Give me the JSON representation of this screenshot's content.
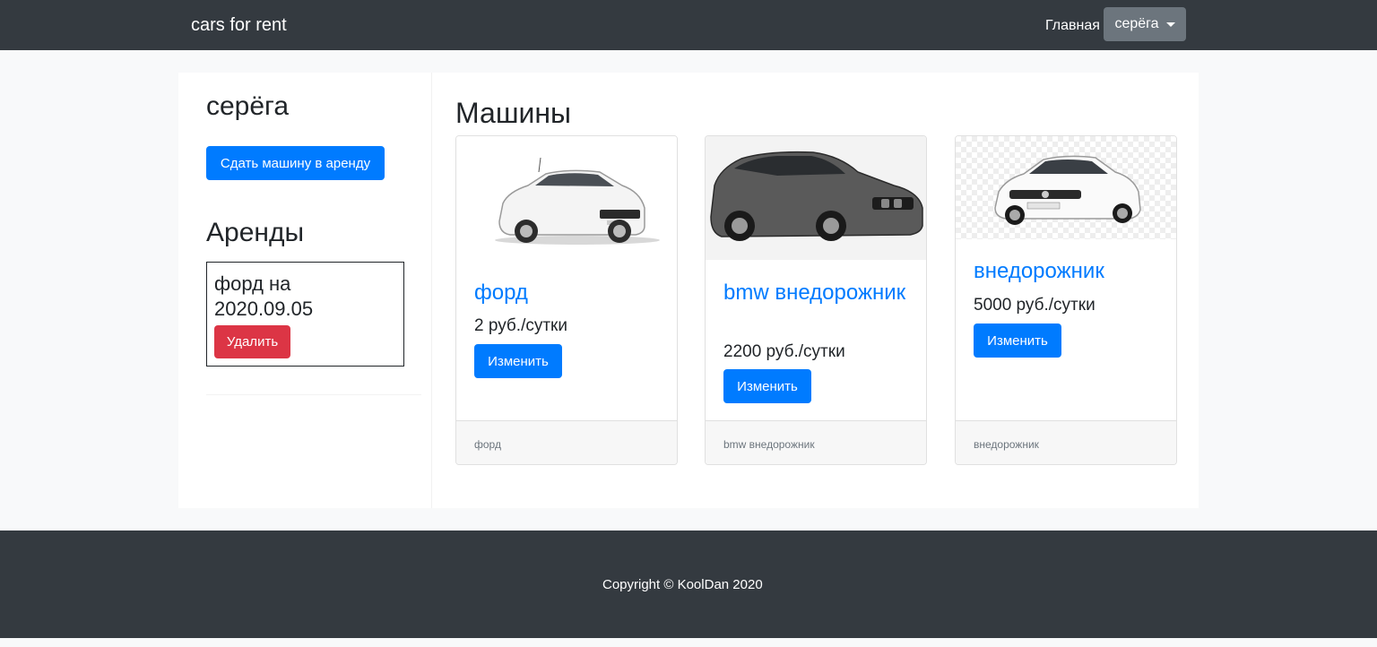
{
  "navbar": {
    "brand": "cars for rent",
    "home_link": "Главная",
    "user_menu": "серёга"
  },
  "sidebar": {
    "username": "серёга",
    "rent_button": "Сдать машину в аренду",
    "rents_heading": "Аренды",
    "rents": [
      {
        "text": "форд на 2020.09.05",
        "delete_label": "Удалить"
      }
    ]
  },
  "main": {
    "heading": "Машины",
    "cars": [
      {
        "title": "форд",
        "price": "2 руб./сутки",
        "edit_label": "Изменить",
        "footer": "форд",
        "color": "white"
      },
      {
        "title": "bmw внедорожник",
        "price": "2200 руб./сутки",
        "edit_label": "Изменить",
        "footer": "bmw внедорожник",
        "color": "dark-gray"
      },
      {
        "title": "внедорожник",
        "price": "5000 руб./сутки",
        "edit_label": "Изменить",
        "footer": "внедорожник",
        "color": "white"
      }
    ]
  },
  "footer": {
    "copyright": "Copyright © KoolDan 2020"
  },
  "colors": {
    "navbar": "#343a40",
    "primary": "#007bff",
    "danger": "#dc3545",
    "secondary": "#6c757d"
  }
}
